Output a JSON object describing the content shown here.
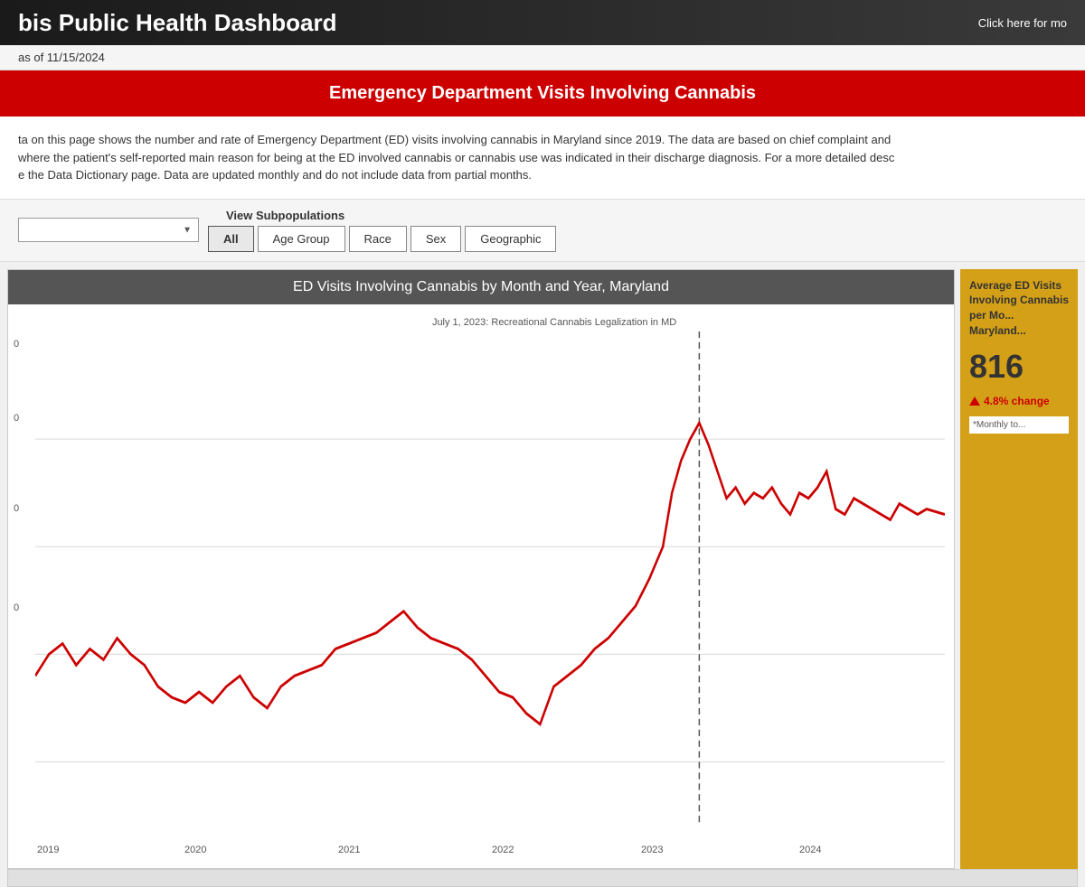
{
  "header": {
    "title": "bis Public Health Dashboard",
    "link_text": "Click here for mo"
  },
  "date_line": {
    "text": "as of 11/15/2024"
  },
  "red_banner": {
    "text": "Emergency Department Visits Involving Cannabis"
  },
  "description": {
    "line1": "ta on this page shows the number and rate of Emergency Department (ED) visits involving cannabis in Maryland since 2019. The data are based on chief complaint and",
    "line2": "where the patient's self-reported main reason for being at the ED involved cannabis or cannabis use was indicated in their discharge diagnosis. For a more detailed desc",
    "line3": "e the Data Dictionary page. Data are updated monthly and do not include data from partial months."
  },
  "filter": {
    "select_placeholder": "",
    "view_subpopulations_label": "View Subpopulations",
    "buttons": [
      {
        "label": "All",
        "active": true
      },
      {
        "label": "Age Group",
        "active": false
      },
      {
        "label": "Race",
        "active": false
      },
      {
        "label": "Sex",
        "active": false
      },
      {
        "label": "Geographic",
        "active": false
      }
    ]
  },
  "chart": {
    "title": "ED Visits Involving Cannabis by Month and Year, Maryland",
    "annotation": "July 1, 2023: Recreational Cannabis Legalization in MD",
    "x_labels": [
      "2019",
      "2020",
      "2021",
      "2022",
      "2023",
      "2024"
    ],
    "y_labels": [
      "0",
      "0",
      "0",
      "0"
    ],
    "dashed_line_x_pct": 73
  },
  "side_panel": {
    "title": "Average ED Visits Involving Cannabis per Mo... Maryland...",
    "number": "816",
    "change_label": "4.8% change",
    "note": "*Monthly to..."
  }
}
